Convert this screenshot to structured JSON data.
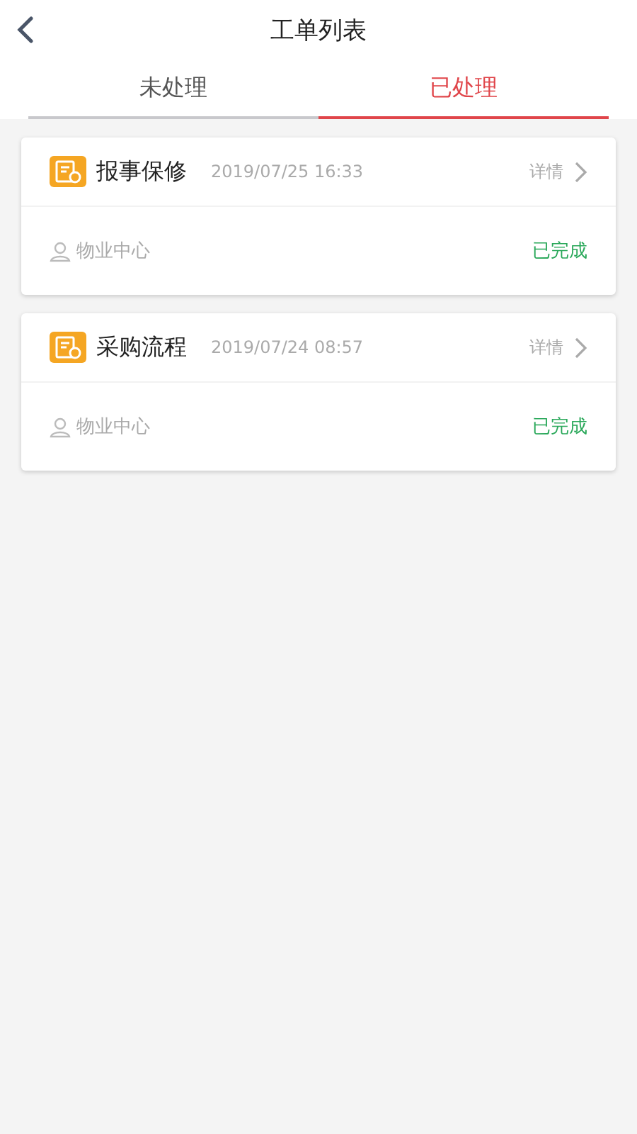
{
  "header": {
    "title": "工单列表"
  },
  "tabs": [
    {
      "label": "未处理",
      "selected": false
    },
    {
      "label": "已处理",
      "selected": true
    }
  ],
  "orders": [
    {
      "title": "报事保修",
      "time": "2019/07/25 16:33",
      "detail": "详情",
      "assignee": "物业中心",
      "status": "已完成"
    },
    {
      "title": "采购流程",
      "time": "2019/07/24 08:57",
      "detail": "详情",
      "assignee": "物业中心",
      "status": "已完成"
    }
  ]
}
